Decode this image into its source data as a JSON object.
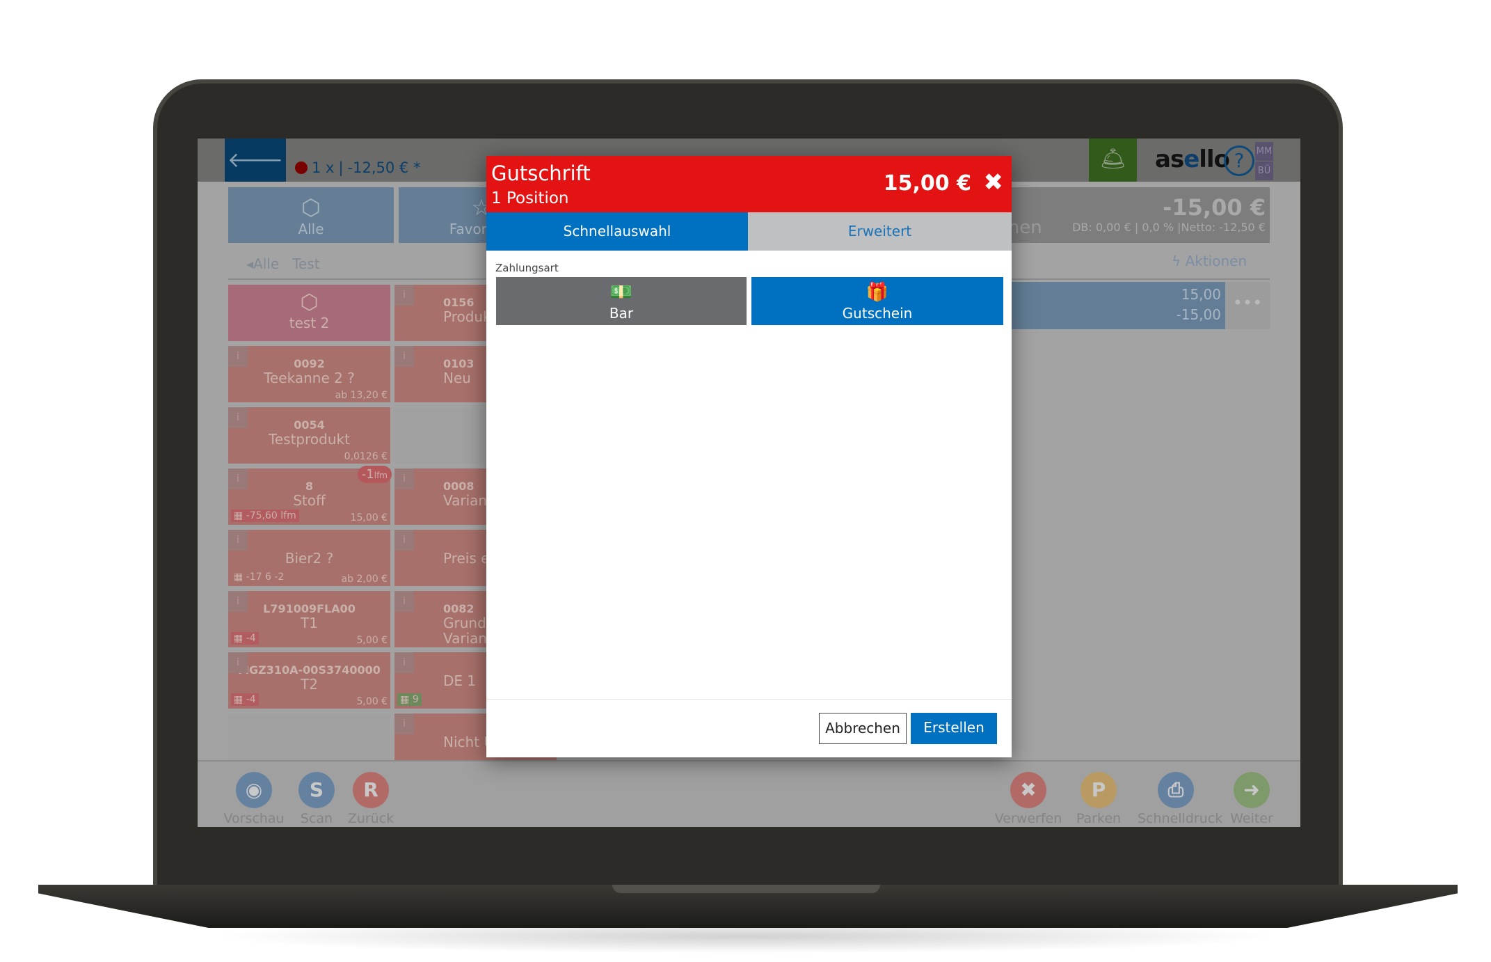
{
  "topbar": {
    "cart_count": "1 x",
    "cart_total": "-12,50 € *",
    "logo_prefix": "as",
    "logo_e": "e",
    "logo_suffix": "llo",
    "help": "?",
    "user_top": "MM",
    "user_bottom": "BÜ"
  },
  "categories": [
    {
      "label": "Alle",
      "icon": "box-icon"
    },
    {
      "label": "Favoriten",
      "icon": "star-icon"
    }
  ],
  "breadcrumb": {
    "back": "Alle",
    "current": "Test"
  },
  "tiles_col1": [
    {
      "name": "test 2",
      "type": "pink"
    },
    {
      "code": "0092",
      "name": "Teekanne 2 ?",
      "price": "ab 13,20 €"
    },
    {
      "code": "0054",
      "name": "Testprodukt",
      "price": "0,0126 €"
    },
    {
      "code": "8",
      "name": "Stoff",
      "price": "15,00 €",
      "stock": "-75,60 lfm",
      "badge": "-1",
      "badge_unit": "lfm"
    },
    {
      "name": "Bier2 ?",
      "price": "ab 2,00 €",
      "stock": "-17   6   -2",
      "stock_plain": true
    },
    {
      "code": "L791009FLA00",
      "name": "T1",
      "price": "5,00 €",
      "stock": "-4"
    },
    {
      "code": "MGZ310A-00S3740000",
      "name": "T2",
      "price": "5,00 €",
      "stock": "-4"
    },
    {
      "type": "empty"
    }
  ],
  "tiles_col2": [
    {
      "code": "0156",
      "name": "Produkt n"
    },
    {
      "code": "0103",
      "name": "Neu"
    },
    {
      "type": "empty"
    },
    {
      "code": "0008",
      "name": "Variantenp"
    },
    {
      "name": "Preis eing"
    },
    {
      "code": "0082",
      "name": "Grundpre",
      "name2": "Varian"
    },
    {
      "name": "DE 1",
      "stock": "9",
      "stock_green": true
    },
    {
      "name": "Nicht Umsat"
    }
  ],
  "summary": {
    "total": "-15,00 €",
    "details": "DB: 0,00 € | 0,0 % |Netto: -12,50 €",
    "positions_label": "Positionen",
    "actions": "Aktionen"
  },
  "line_item": {
    "price": "15,00",
    "total": "-15,00",
    "more": "•••"
  },
  "bottom_actions": [
    {
      "label": "Vorschau",
      "letter": "◉",
      "color": "#6581a0",
      "icon": "eye-icon"
    },
    {
      "label": "Scan",
      "letter": "S",
      "color": "#6581a0",
      "icon": "scan-icon"
    },
    {
      "label": "Zurück",
      "letter": "R",
      "color": "#b26a66",
      "icon": "return-icon"
    },
    {
      "label": "Verwerfen",
      "letter": "✖",
      "color": "#b26a66",
      "icon": "discard-icon"
    },
    {
      "label": "Parken",
      "letter": "P",
      "color": "#b89a62",
      "icon": "park-icon"
    },
    {
      "label": "Schnelldruck",
      "letter": "⎙",
      "color": "#6581a0",
      "icon": "print-icon"
    },
    {
      "label": "Weiter",
      "letter": "➜",
      "color": "#7f9a6a",
      "icon": "next-icon"
    }
  ],
  "modal": {
    "title": "Gutschrift",
    "subtitle": "1 Position",
    "amount": "15,00 €",
    "close": "✖",
    "tabs": [
      {
        "label": "Schnellauswahl",
        "active": true
      },
      {
        "label": "Erweitert",
        "active": false
      }
    ],
    "payment_label": "Zahlungsart",
    "payment_options": [
      {
        "label": "Bar",
        "icon": "cash-icon",
        "selected": false
      },
      {
        "label": "Gutschein",
        "icon": "gift-icon",
        "selected": true
      }
    ],
    "cancel": "Abbrechen",
    "create": "Erstellen"
  },
  "colors": {
    "header_red": "#e31313",
    "primary_blue": "#0070c0",
    "cash_gray": "#696b6f"
  }
}
